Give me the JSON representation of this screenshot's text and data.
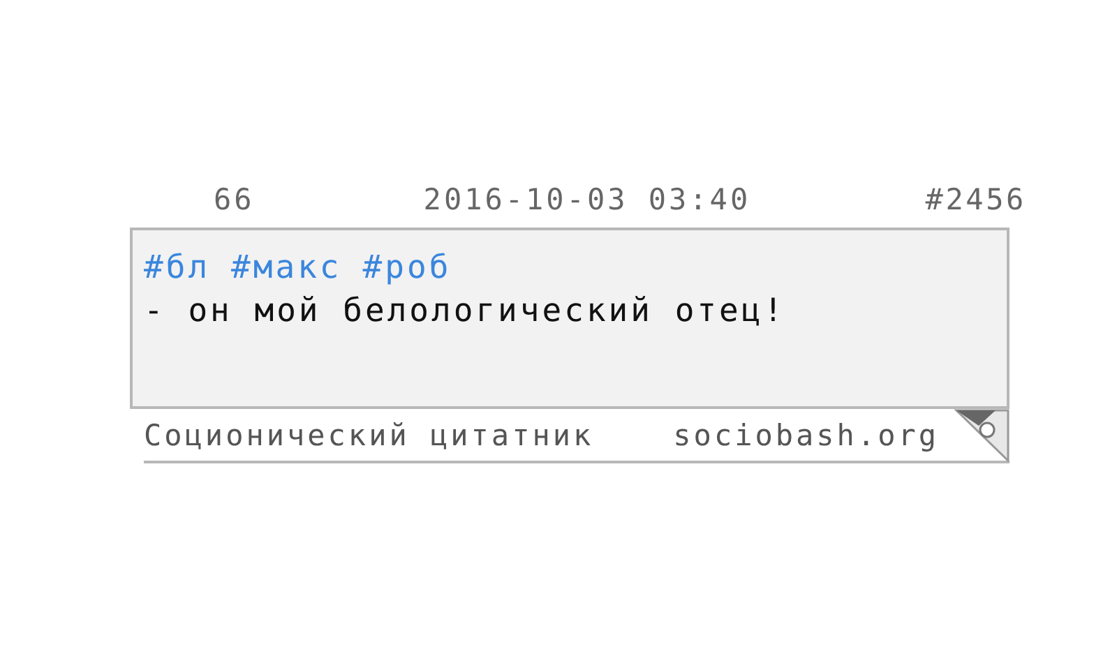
{
  "quote": {
    "rating": "66",
    "date": "2016-10-03 03:40",
    "number": "#2456",
    "tags": [
      "#бл",
      "#макс",
      "#роб"
    ],
    "text": "- он мой белологический отец!"
  },
  "footer": {
    "title": "Соционический цитатник",
    "site": "sociobash.org"
  }
}
